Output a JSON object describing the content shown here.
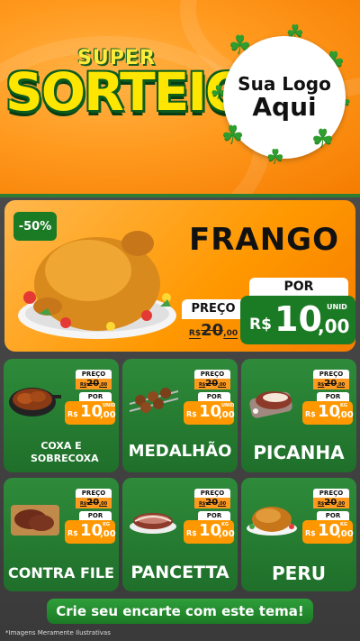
{
  "header": {
    "title_small": "SUPER",
    "title_big": "SORTEIO",
    "logo_line1": "Sua Logo",
    "logo_line2": "Aqui",
    "clover_icon": "☘"
  },
  "feature": {
    "discount": "-50%",
    "name": "FRANGO",
    "preco_label": "PREÇO",
    "old_price": "20",
    "old_cents": ",00",
    "old_currency": "R$",
    "por_label": "POR",
    "currency": "R$",
    "price_int": "10",
    "price_cents": ",00",
    "unit": "UNID"
  },
  "products": [
    {
      "name": "COXA E SOBRECOXA",
      "unit": "UNID",
      "preco_label": "PREÇO",
      "old_price": "20",
      "old_cents": ",00",
      "old_currency": "R$",
      "por_label": "POR",
      "currency": "R$",
      "price_int": "10",
      "price_cents": ",00"
    },
    {
      "name": "MEDALHÃO",
      "unit": "UNID",
      "preco_label": "PREÇO",
      "old_price": "20",
      "old_cents": ",00",
      "old_currency": "R$",
      "por_label": "POR",
      "currency": "R$",
      "price_int": "10",
      "price_cents": ",00"
    },
    {
      "name": "PICANHA",
      "unit": "KG",
      "preco_label": "PREÇO",
      "old_price": "20",
      "old_cents": ",00",
      "old_currency": "R$",
      "por_label": "POR",
      "currency": "R$",
      "price_int": "10",
      "price_cents": ",00"
    },
    {
      "name": "CONTRA FILE",
      "unit": "KG",
      "preco_label": "PREÇO",
      "old_price": "20",
      "old_cents": ",00",
      "old_currency": "R$",
      "por_label": "POR",
      "currency": "R$",
      "price_int": "10",
      "price_cents": ",00"
    },
    {
      "name": "PANCETTA",
      "unit": "KG",
      "preco_label": "PREÇO",
      "old_price": "20",
      "old_cents": ",00",
      "old_currency": "R$",
      "por_label": "POR",
      "currency": "R$",
      "price_int": "10",
      "price_cents": ",00"
    },
    {
      "name": "PERU",
      "unit": "KG",
      "preco_label": "PREÇO",
      "old_price": "20",
      "old_cents": ",00",
      "old_currency": "R$",
      "por_label": "POR",
      "currency": "R$",
      "price_int": "10",
      "price_cents": ",00"
    }
  ],
  "cta": "Crie seu encarte com este tema!",
  "disclaimer": "*Imagens Meramente Ilustrativas",
  "colors": {
    "orange": "#ff9800",
    "green": "#1b7a24",
    "yellow": "#ffe600"
  }
}
